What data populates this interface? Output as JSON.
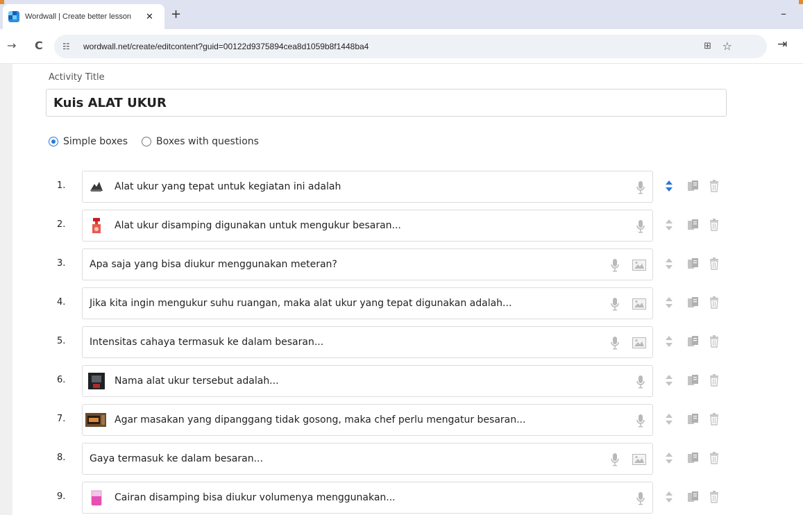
{
  "browser": {
    "tab_title": "Wordwall | Create better lesson",
    "tab_close": "✕",
    "new_tab": "+",
    "minimize": "–",
    "back": "→",
    "reload": "C",
    "site_icon": "☷",
    "url": "wordwall.net/create/editcontent?guid=00122d9375894cea8d1059b8f1448ba4",
    "translate": "⊞",
    "bookmark": "☆",
    "extensions": "⇥"
  },
  "editor": {
    "title_label": "Activity Title",
    "title_value": "Kuis ALAT UKUR",
    "options": [
      {
        "label": "Simple boxes",
        "selected": true
      },
      {
        "label": "Boxes with questions",
        "selected": false
      }
    ]
  },
  "items": [
    {
      "number": "1.",
      "text": "Alat ukur yang tepat untuk kegiatan ini adalah",
      "has_image": true,
      "image": "tools-photo",
      "active_sort": true
    },
    {
      "number": "2.",
      "text": "Alat ukur disamping digunakan untuk mengukur besaran...",
      "has_image": true,
      "image": "red-bottle-photo",
      "active_sort": false
    },
    {
      "number": "3.",
      "text": "Apa saja yang bisa diukur menggunakan meteran?",
      "has_image": false,
      "active_sort": false
    },
    {
      "number": "4.",
      "text": "Jika kita ingin mengukur suhu ruangan, maka alat ukur yang tepat digunakan adalah...",
      "has_image": false,
      "active_sort": false
    },
    {
      "number": "5.",
      "text": "Intensitas cahaya termasuk ke dalam besaran...",
      "has_image": false,
      "active_sort": false
    },
    {
      "number": "6.",
      "text": "Nama alat ukur tersebut adalah...",
      "has_image": true,
      "image": "device-photo",
      "active_sort": false
    },
    {
      "number": "7.",
      "text": "Agar masakan yang dipanggang tidak gosong, maka chef perlu mengatur besaran...",
      "has_image": true,
      "image": "oven-photo",
      "active_sort": false
    },
    {
      "number": "8.",
      "text": "Gaya termasuk ke dalam besaran...",
      "has_image": false,
      "active_sort": false
    },
    {
      "number": "9.",
      "text": "Cairan disamping bisa diukur volumenya menggunakan...",
      "has_image": true,
      "image": "beaker-photo",
      "active_sort": false
    }
  ],
  "colors": {
    "accent": "#2a78d6",
    "icon_gray": "#b9b9b9",
    "tab_strip": "#dfe3f1"
  }
}
